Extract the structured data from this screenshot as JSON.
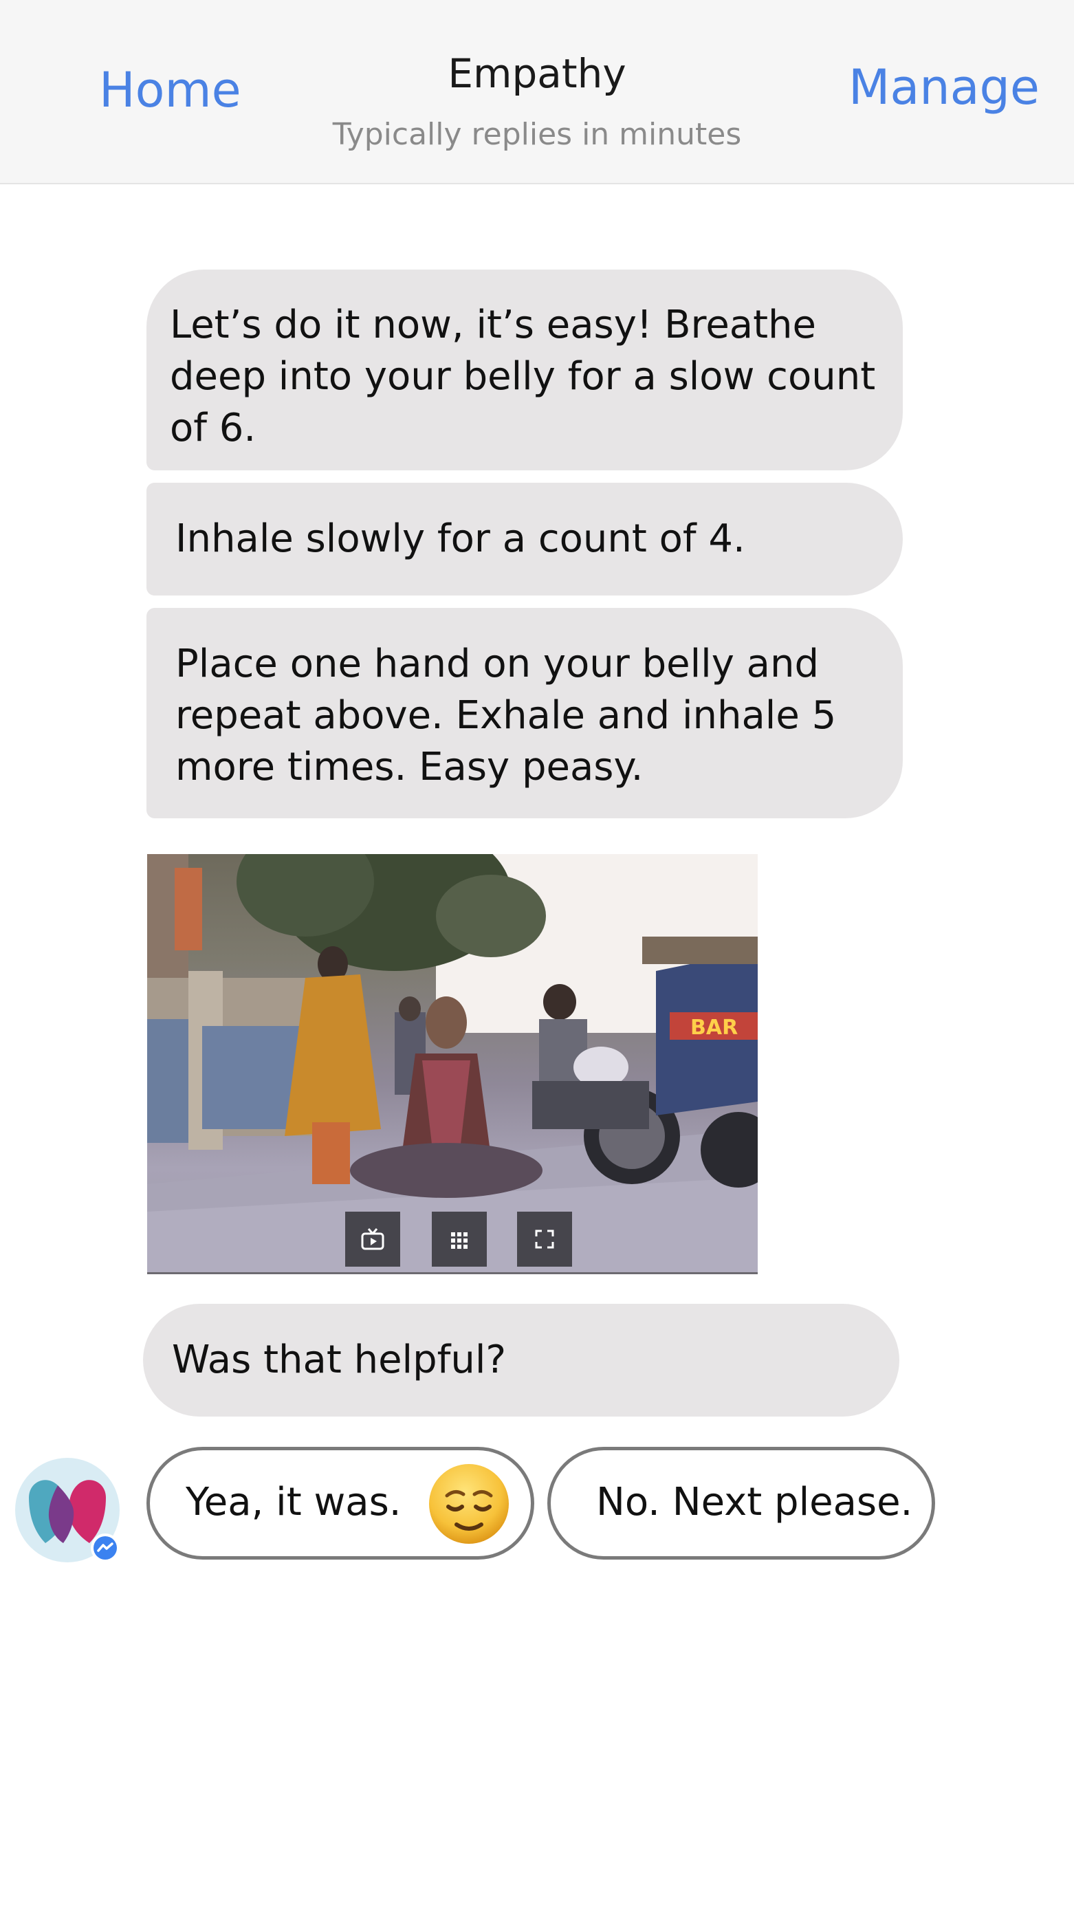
{
  "header": {
    "home_label": "Home",
    "title": "Empathy",
    "subtitle": "Typically replies in minutes",
    "manage_label": "Manage"
  },
  "messages": [
    {
      "text": "Let’s do it now, it’s easy! Breathe deep into your belly for a slow count of 6."
    },
    {
      "text": "Inhale slowly for a count of 4."
    },
    {
      "text": "Place one hand on your belly and repeat above. Exhale and inhale 5 more times. Easy peasy."
    },
    {
      "text": "Was that helpful?"
    }
  ],
  "media": {
    "controls": [
      "tv-icon",
      "grid-icon",
      "fullscreen-icon"
    ],
    "sign_text": "BAR"
  },
  "quick_replies": [
    {
      "label": "Yea, it was.",
      "emoji": "relieved-face-emoji"
    },
    {
      "label": "No. Next please."
    }
  ],
  "colors": {
    "accent": "#4a82e4",
    "bubble": "#e7e5e6",
    "header_bg": "#f6f6f6",
    "quick_reply_border": "#7a7a7a"
  }
}
